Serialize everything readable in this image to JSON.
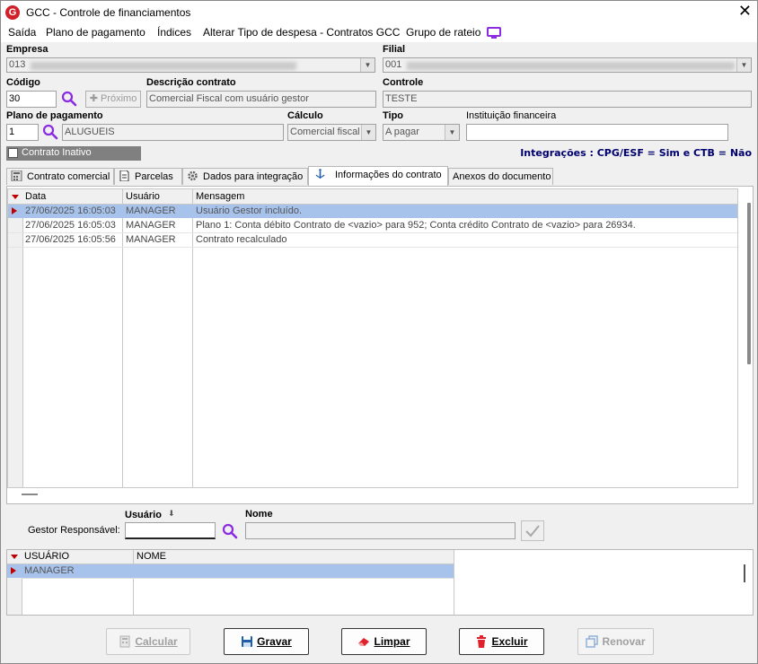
{
  "window": {
    "title": "GCC - Controle de financiamentos",
    "close_glyph": "✕"
  },
  "menu": [
    "Saída",
    "Plano de pagamento",
    "Índices",
    "Alterar Tipo de despesa - Contratos GCC",
    "Grupo de rateio"
  ],
  "empresa": {
    "label": "Empresa",
    "value": "013"
  },
  "filial": {
    "label": "Filial",
    "value": "001"
  },
  "codigo": {
    "label": "Código",
    "value": "30",
    "next_label": "Próximo"
  },
  "descricao": {
    "label": "Descrição contrato",
    "value": "Comercial Fiscal com usuário gestor"
  },
  "controle": {
    "label": "Controle",
    "value": "TESTE"
  },
  "plano": {
    "label": "Plano de pagamento",
    "code": "1",
    "name": "ALUGUEIS"
  },
  "calculo": {
    "label": "Cálculo",
    "value": "Comercial fiscal"
  },
  "tipo": {
    "label": "Tipo",
    "value": "A pagar"
  },
  "instituicao": {
    "label": "Instituição financeira",
    "value": ""
  },
  "inativo": {
    "label": "Contrato Inativo",
    "checked": false
  },
  "integracoes": "Integrações : CPG/ESF = Sim e CTB = Não",
  "tabs": [
    "Contrato comercial",
    "Parcelas",
    "Dados para integração",
    "Informações do contrato",
    "Anexos do documento"
  ],
  "active_tab": "Informações do contrato",
  "log": {
    "columns": [
      "Data",
      "Usuário",
      "Mensagem"
    ],
    "rows": [
      {
        "data": "27/06/2025 16:05:03",
        "usuario": "MANAGER",
        "mensagem": "Usuário Gestor incluído."
      },
      {
        "data": "27/06/2025 16:05:03",
        "usuario": "MANAGER",
        "mensagem": "Plano 1: Conta débito Contrato de <vazio> para 952; Conta crédito Contrato de <vazio> para 26934."
      },
      {
        "data": "27/06/2025 16:05:56",
        "usuario": "MANAGER",
        "mensagem": "Contrato recalculado"
      }
    ]
  },
  "gestor": {
    "label": "Gestor Responsável:",
    "usuario_label": "Usuário",
    "nome_label": "Nome",
    "usuario_value": "",
    "nome_value": ""
  },
  "users_grid": {
    "columns": [
      "USUÁRIO",
      "NOME"
    ],
    "rows": [
      {
        "usuario": "MANAGER",
        "nome": ""
      }
    ]
  },
  "buttons": {
    "calcular": "Calcular",
    "gravar": "Gravar",
    "limpar": "Limpar",
    "excluir": "Excluir",
    "renovar": "Renovar"
  },
  "colors": {
    "accent_purple": "#8a2be2",
    "integ_blue": "#00006e",
    "selection": "#a7c3ec",
    "indicator_red": "#c00000"
  },
  "icons": [
    "app-logo-icon",
    "close-icon",
    "monitor-icon",
    "search-icon",
    "plus-icon",
    "dropdown-arrow-icon",
    "calculator-icon",
    "document-icon",
    "gear-icon",
    "info-anchor-icon",
    "sort-arrow-icon",
    "check-icon",
    "save-icon",
    "eraser-icon",
    "trash-icon",
    "copy-icon"
  ]
}
